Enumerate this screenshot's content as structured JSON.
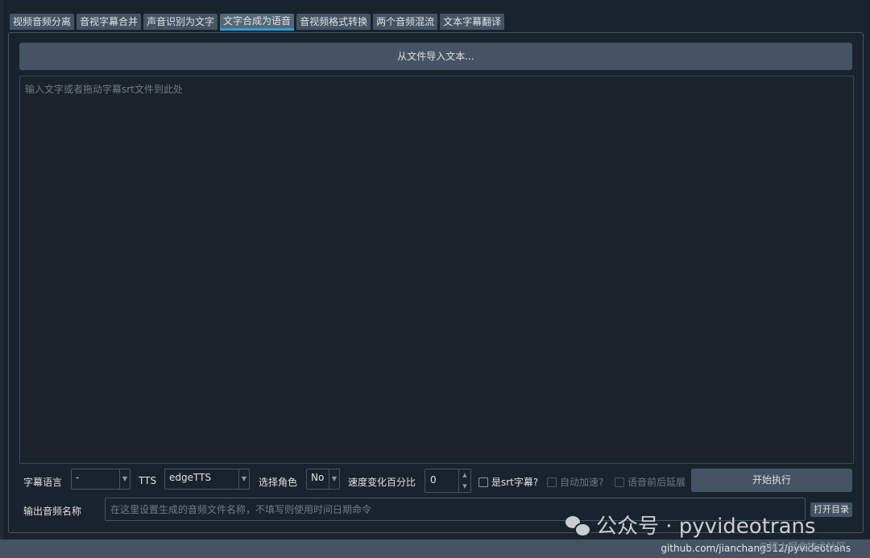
{
  "tabs": [
    {
      "label": "视频音频分离",
      "active": false
    },
    {
      "label": "音视字幕合并",
      "active": false
    },
    {
      "label": "声音识别为文字",
      "active": false
    },
    {
      "label": "文字合成为语音",
      "active": true
    },
    {
      "label": "音视频格式转换",
      "active": false
    },
    {
      "label": "两个音频混流",
      "active": false
    },
    {
      "label": "文本字幕翻译",
      "active": false
    }
  ],
  "import_button": "从文件导入文本...",
  "text_placeholder": "输入文字或者拖动字幕srt文件到此处",
  "controls": {
    "subtitle_lang_label": "字幕语言",
    "subtitle_lang_value": "-",
    "tts_label": "TTS",
    "tts_value": "edgeTTS",
    "role_label": "选择角色",
    "role_value": "No",
    "speed_label": "速度变化百分比",
    "speed_value": "0",
    "srt_checkbox": "是srt字幕?",
    "auto_speed_checkbox": "自动加速?",
    "delay_checkbox": "语音前后延展",
    "run_button": "开始执行"
  },
  "output": {
    "label": "输出音频名称",
    "placeholder": "在这里设置生成的音频文件名称，不填写则使用时间日期命令",
    "open_dir_button": "打开目录"
  },
  "watermark": {
    "text": "公众号 · pyvideotrans",
    "corner": "@稀土掘金技术社区"
  },
  "status": {
    "github": "github.com/jianchang512/pyvideotrans"
  },
  "colors": {
    "background": "#19232d",
    "button": "#455364",
    "active_tab_underline": "#2b9fd8"
  }
}
